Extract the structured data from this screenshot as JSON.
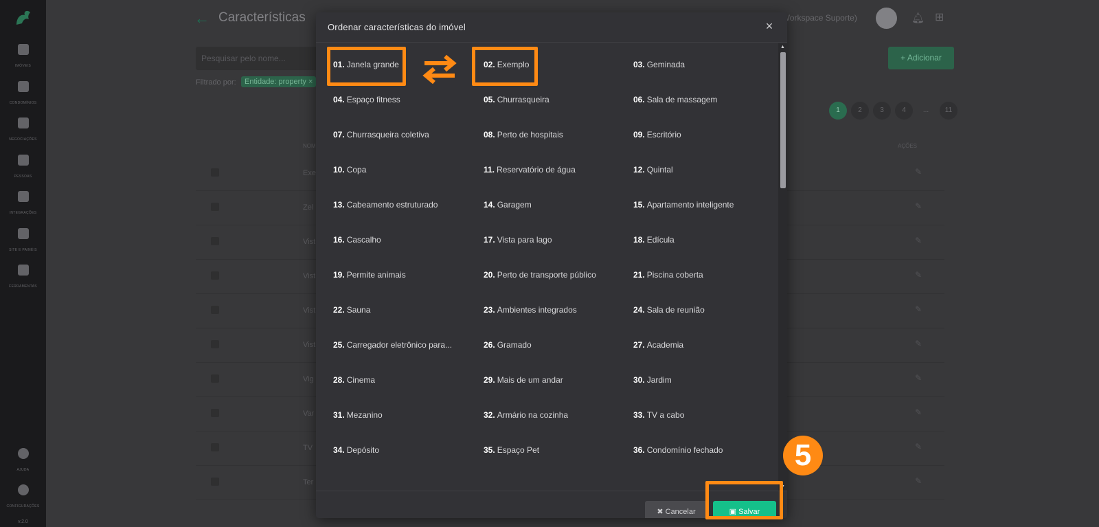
{
  "app": {
    "title": "Características",
    "workspace": "el (Workspace Suporte)",
    "version": "v.2.0"
  },
  "sidebar": {
    "items": [
      {
        "label": "Imóveis",
        "icon": "home-icon"
      },
      {
        "label": "Condomínios",
        "icon": "building-icon"
      },
      {
        "label": "Negociações",
        "icon": "diamond-icon"
      },
      {
        "label": "Pessoas",
        "icon": "people-icon"
      },
      {
        "label": "Integrações",
        "icon": "integration-icon"
      },
      {
        "label": "Site e Painéis",
        "icon": "laptop-icon"
      },
      {
        "label": "Ferramentas",
        "icon": "tools-icon"
      }
    ],
    "bottom": [
      {
        "label": "Ajuda",
        "icon": "help-icon"
      },
      {
        "label": "Configurações",
        "icon": "gear-icon"
      }
    ]
  },
  "main": {
    "search_placeholder": "Pesquisar pelo nome...",
    "filter_label": "Filtrado por:",
    "filter_chip": "Entidade: property ×",
    "add_button": "+ Adicionar",
    "pagination": [
      "1",
      "2",
      "3",
      "4",
      "...",
      "11"
    ],
    "table": {
      "col_name": "NOME",
      "col_actions": "AÇÕES",
      "rows": [
        "Exe",
        "Zel",
        "Vist",
        "Vist",
        "Vist",
        "Vist",
        "Vig",
        "Var",
        "TV",
        "Ter"
      ]
    }
  },
  "modal": {
    "title": "Ordenar características do imóvel",
    "close_label": "×",
    "features": [
      {
        "num": "01.",
        "label": "Janela grande"
      },
      {
        "num": "02.",
        "label": "Exemplo"
      },
      {
        "num": "03.",
        "label": "Geminada"
      },
      {
        "num": "04.",
        "label": "Espaço fitness"
      },
      {
        "num": "05.",
        "label": "Churrasqueira"
      },
      {
        "num": "06.",
        "label": "Sala de massagem"
      },
      {
        "num": "07.",
        "label": "Churrasqueira coletiva"
      },
      {
        "num": "08.",
        "label": "Perto de hospitais"
      },
      {
        "num": "09.",
        "label": "Escritório"
      },
      {
        "num": "10.",
        "label": "Copa"
      },
      {
        "num": "11.",
        "label": "Reservatório de água"
      },
      {
        "num": "12.",
        "label": "Quintal"
      },
      {
        "num": "13.",
        "label": "Cabeamento estruturado"
      },
      {
        "num": "14.",
        "label": "Garagem"
      },
      {
        "num": "15.",
        "label": "Apartamento inteligente"
      },
      {
        "num": "16.",
        "label": "Cascalho"
      },
      {
        "num": "17.",
        "label": "Vista para lago"
      },
      {
        "num": "18.",
        "label": "Edícula"
      },
      {
        "num": "19.",
        "label": "Permite animais"
      },
      {
        "num": "20.",
        "label": "Perto de transporte público"
      },
      {
        "num": "21.",
        "label": "Piscina coberta"
      },
      {
        "num": "22.",
        "label": "Sauna"
      },
      {
        "num": "23.",
        "label": "Ambientes integrados"
      },
      {
        "num": "24.",
        "label": "Sala de reunião"
      },
      {
        "num": "25.",
        "label": "Carregador eletrônico para..."
      },
      {
        "num": "26.",
        "label": "Gramado"
      },
      {
        "num": "27.",
        "label": "Academia"
      },
      {
        "num": "28.",
        "label": "Cinema"
      },
      {
        "num": "29.",
        "label": "Mais de um andar"
      },
      {
        "num": "30.",
        "label": "Jardim"
      },
      {
        "num": "31.",
        "label": "Mezanino"
      },
      {
        "num": "32.",
        "label": "Armário na cozinha"
      },
      {
        "num": "33.",
        "label": "TV a cabo"
      },
      {
        "num": "34.",
        "label": "Depósito"
      },
      {
        "num": "35.",
        "label": "Espaço Pet"
      },
      {
        "num": "36.",
        "label": "Condomínio fechado"
      }
    ],
    "cancel_label": "Cancelar",
    "save_label": "Salvar"
  },
  "tutorial": {
    "step": "5",
    "highlight_color": "#ff8a14"
  }
}
